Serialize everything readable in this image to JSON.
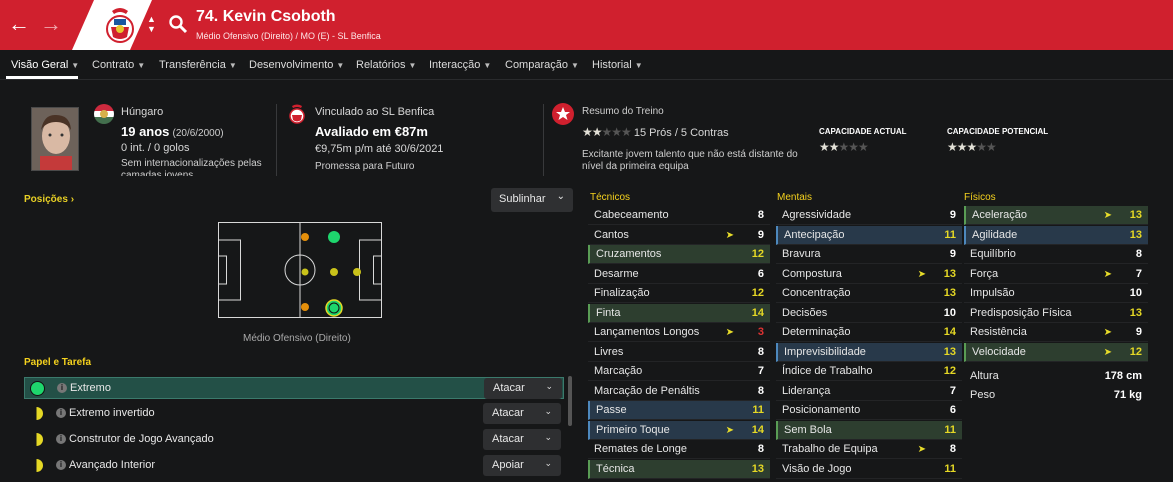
{
  "header": {
    "player_title": "74. Kevin Csoboth",
    "player_subtitle": "Médio Ofensivo (Direito) / MO (E) - SL Benfica",
    "back_icon": "arrow-left-icon",
    "forward_icon": "arrow-right-icon",
    "search_icon": "search-icon",
    "club_crest": "benfica-crest",
    "accent": "#d0202e"
  },
  "menu": [
    {
      "label": "Visão Geral",
      "active": true
    },
    {
      "label": "Contrato"
    },
    {
      "label": "Transferência"
    },
    {
      "label": "Desenvolvimento"
    },
    {
      "label": "Relatórios"
    },
    {
      "label": "Interacção"
    },
    {
      "label": "Comparação"
    },
    {
      "label": "Historial"
    }
  ],
  "bio": {
    "nationality": "Húngaro",
    "age": "19 anos",
    "dob": "(20/6/2000)",
    "caps": "0 int. / 0 golos",
    "intl": "Sem internacionalizações pelas camadas jovens"
  },
  "contract": {
    "club": "Vinculado ao SL Benfica",
    "value": "Avaliado em €87m",
    "wage": "€9,75m p/m até 30/6/2021",
    "status": "Promessa para Futuro"
  },
  "training": {
    "title": "Resumo do Treino",
    "stars": 2,
    "pros_cons": "15 Prós / 5 Contras",
    "current_label": "CAPACIDADE ACTUAL",
    "potential_label": "CAPACIDADE POTENCIAL",
    "current_stars": 2,
    "potential_stars": 3,
    "summary": "Excitante jovem talento que não está distante do nível da primeira equipa"
  },
  "positions": {
    "title": "Posições",
    "caption": "Médio Ofensivo (Direito)",
    "highlight_button": "Sublinhar"
  },
  "roles": {
    "title": "Papel e Tarefa",
    "items": [
      {
        "name": "Extremo",
        "duty": "Atacar",
        "suit": "green",
        "selected": true
      },
      {
        "name": "Extremo invertido",
        "duty": "Atacar",
        "suit": "yellow-half"
      },
      {
        "name": "Construtor de Jogo Avançado",
        "duty": "Atacar",
        "suit": "yellow-half"
      },
      {
        "name": "Avançado Interior",
        "duty": "Apoiar",
        "suit": "yellow-half"
      }
    ]
  },
  "technical": {
    "title": "Técnicos",
    "attrs": [
      {
        "name": "Cabeceamento",
        "value": "8"
      },
      {
        "name": "Cantos",
        "value": "9",
        "arrow": true
      },
      {
        "name": "Cruzamentos",
        "value": "12",
        "hl": "g",
        "vc": "g"
      },
      {
        "name": "Desarme",
        "value": "6"
      },
      {
        "name": "Finalização",
        "value": "12",
        "vc": "g"
      },
      {
        "name": "Finta",
        "value": "14",
        "hl": "g",
        "vc": "g"
      },
      {
        "name": "Lançamentos Longos",
        "value": "3",
        "arrow": true,
        "vc": "r"
      },
      {
        "name": "Livres",
        "value": "8"
      },
      {
        "name": "Marcação",
        "value": "7"
      },
      {
        "name": "Marcação de Penáltis",
        "value": "8"
      },
      {
        "name": "Passe",
        "value": "11",
        "hl": "b",
        "vc": "g"
      },
      {
        "name": "Primeiro Toque",
        "value": "14",
        "hl": "b",
        "arrow": true,
        "vc": "g"
      },
      {
        "name": "Remates de Longe",
        "value": "8"
      },
      {
        "name": "Técnica",
        "value": "13",
        "hl": "g",
        "vc": "g"
      }
    ]
  },
  "mental": {
    "title": "Mentais",
    "attrs": [
      {
        "name": "Agressividade",
        "value": "9"
      },
      {
        "name": "Antecipação",
        "value": "11",
        "hl": "b",
        "vc": "g"
      },
      {
        "name": "Bravura",
        "value": "9"
      },
      {
        "name": "Compostura",
        "value": "13",
        "arrow": true,
        "vc": "g"
      },
      {
        "name": "Concentração",
        "value": "13",
        "vc": "g"
      },
      {
        "name": "Decisões",
        "value": "10"
      },
      {
        "name": "Determinação",
        "value": "14",
        "vc": "g"
      },
      {
        "name": "Imprevisibilidade",
        "value": "13",
        "hl": "b",
        "vc": "g"
      },
      {
        "name": "Índice de Trabalho",
        "value": "12",
        "vc": "g"
      },
      {
        "name": "Liderança",
        "value": "7"
      },
      {
        "name": "Posicionamento",
        "value": "6"
      },
      {
        "name": "Sem Bola",
        "value": "11",
        "hl": "g",
        "vc": "g"
      },
      {
        "name": "Trabalho de Equipa",
        "value": "8",
        "arrow": true
      },
      {
        "name": "Visão de Jogo",
        "value": "11",
        "vc": "g"
      }
    ]
  },
  "physical": {
    "title": "Físicos",
    "attrs": [
      {
        "name": "Aceleração",
        "value": "13",
        "hl": "g",
        "arrow": true,
        "vc": "g"
      },
      {
        "name": "Agilidade",
        "value": "13",
        "hl": "b",
        "vc": "g"
      },
      {
        "name": "Equilíbrio",
        "value": "8"
      },
      {
        "name": "Força",
        "value": "7",
        "arrow": true
      },
      {
        "name": "Impulsão",
        "value": "10"
      },
      {
        "name": "Predisposição Física",
        "value": "13",
        "vc": "g"
      },
      {
        "name": "Resistência",
        "value": "9",
        "arrow": true
      },
      {
        "name": "Velocidade",
        "value": "12",
        "hl": "g",
        "arrow": true,
        "vc": "g"
      }
    ],
    "height_label": "Altura",
    "height": "178 cm",
    "weight_label": "Peso",
    "weight": "71 kg"
  }
}
